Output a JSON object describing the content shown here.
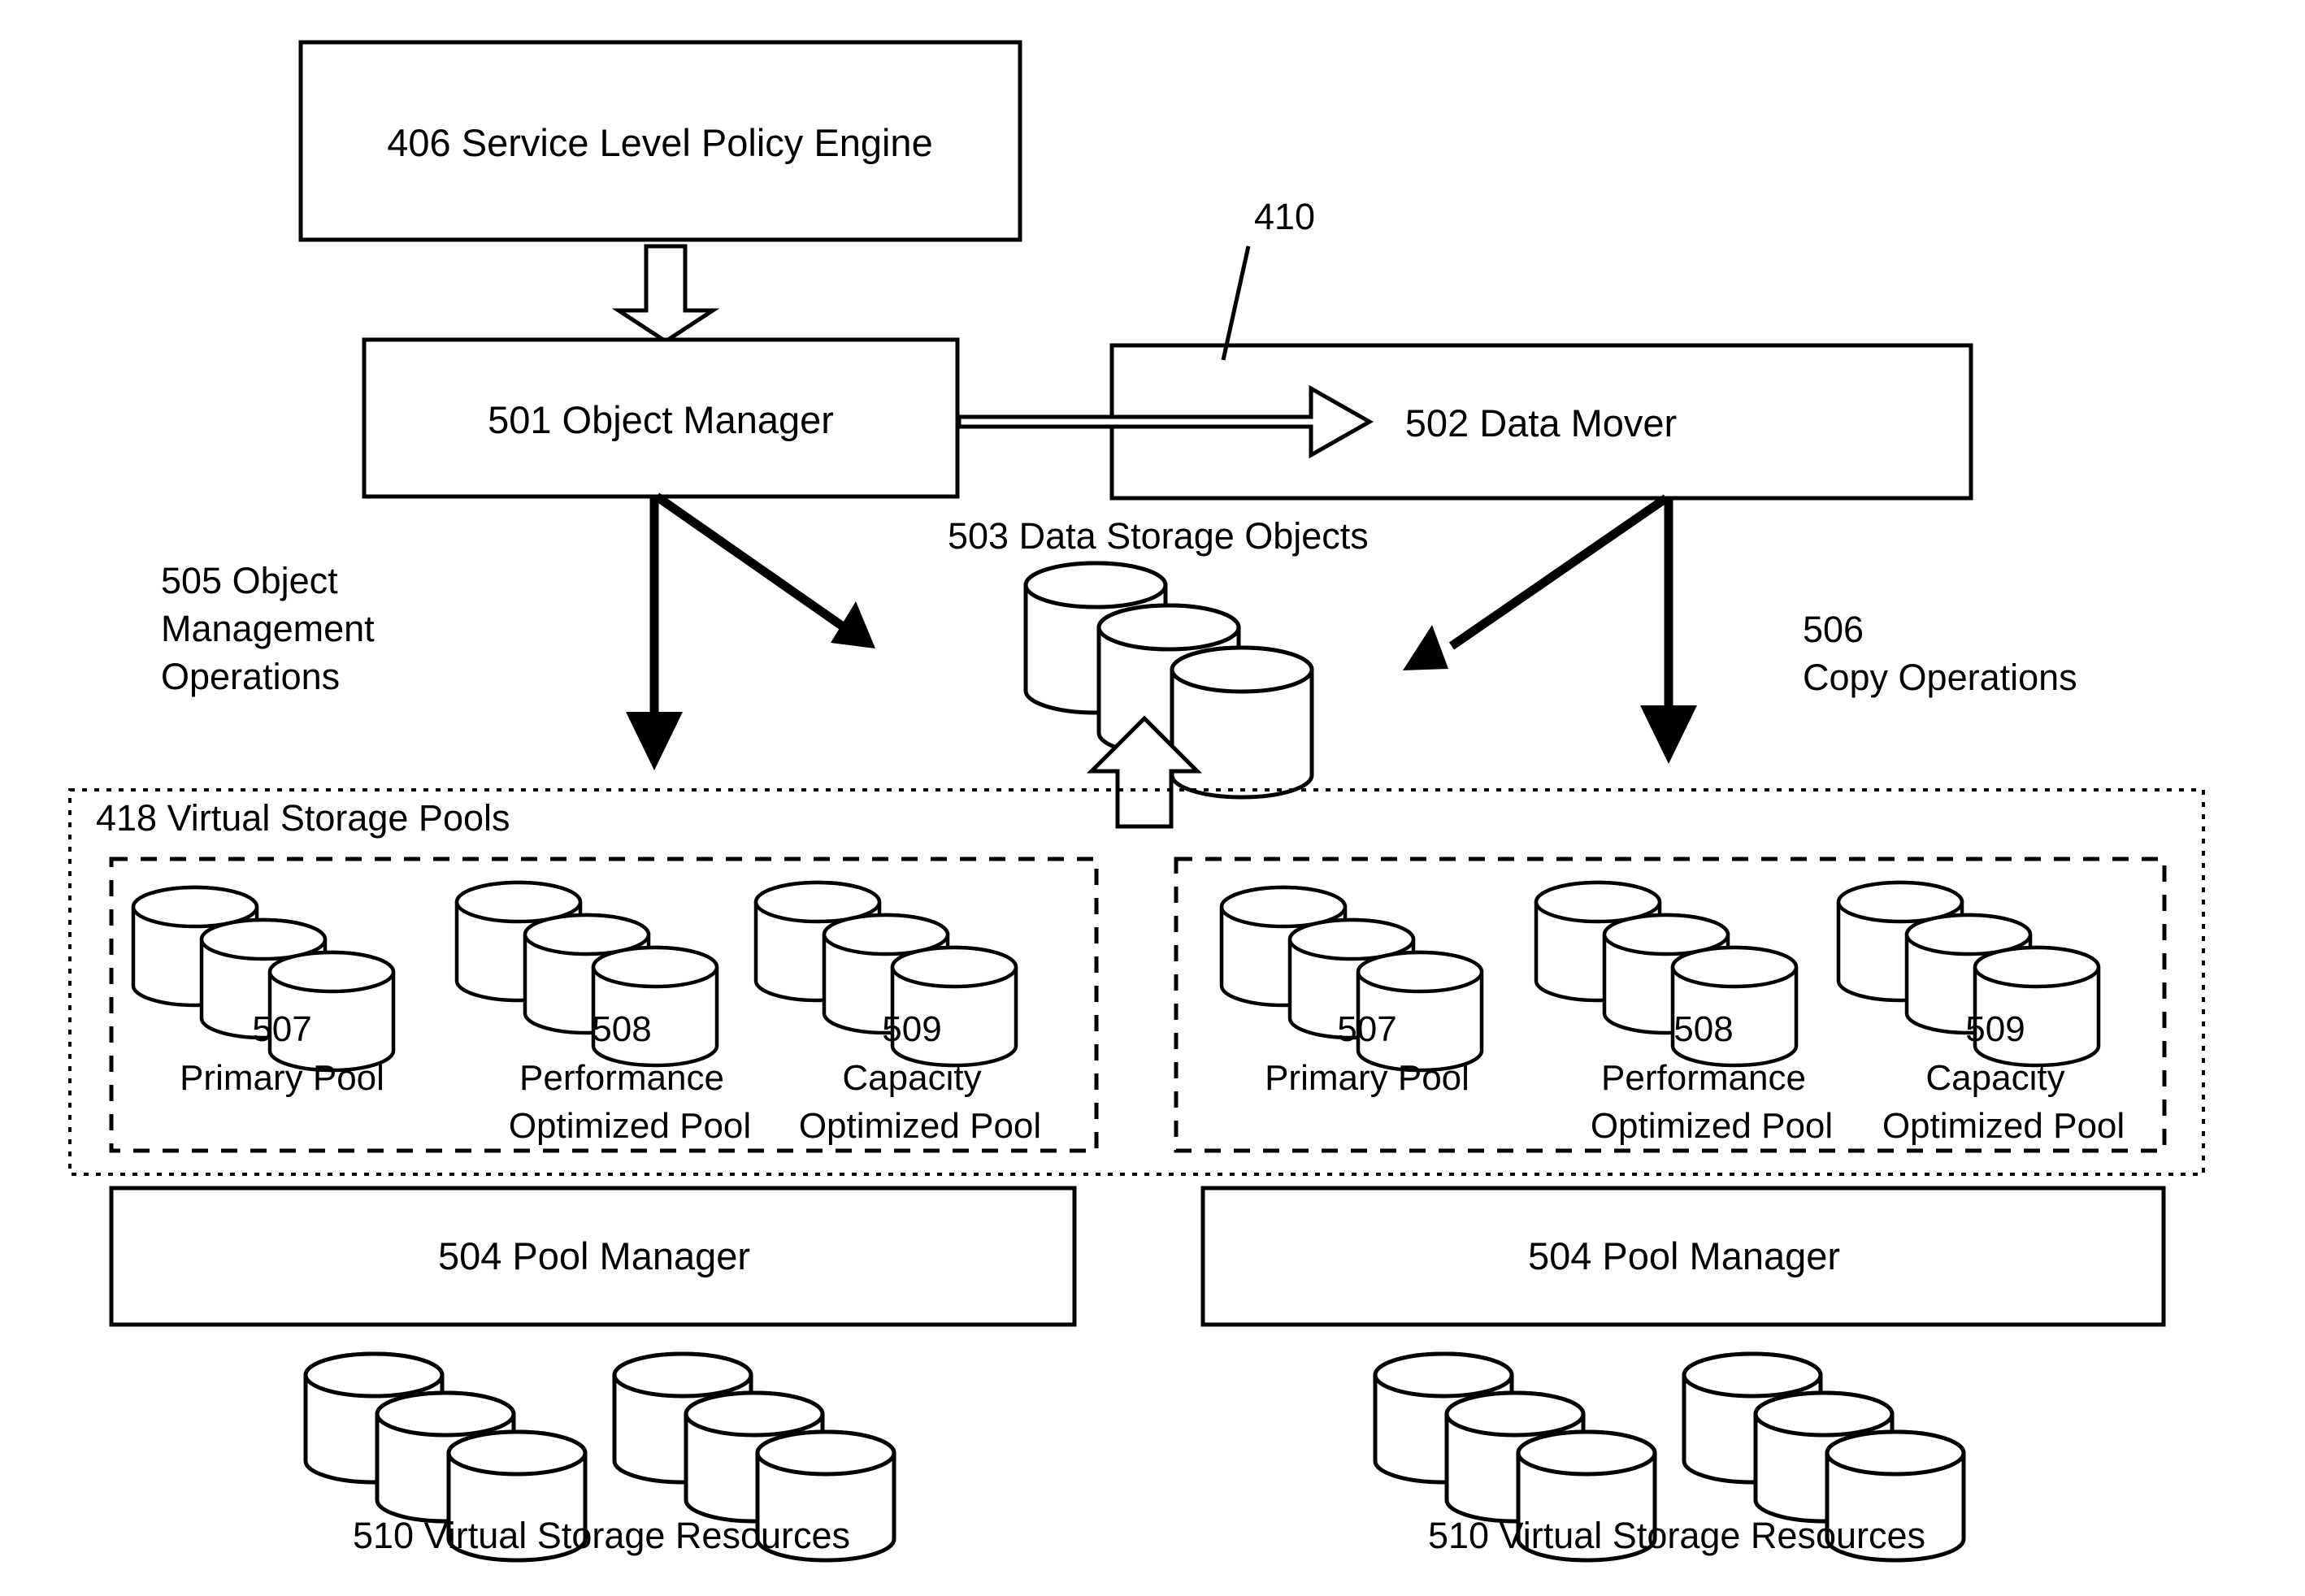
{
  "figure": {
    "title_blocks": {
      "policy_engine": "406 Service Level Policy Engine",
      "object_manager": "501 Object Manager",
      "data_mover": "502 Data Mover",
      "pool_manager_left": "504 Pool Manager",
      "pool_manager_right": "504 Pool Manager"
    },
    "labels": {
      "ref_410": "410",
      "object_mgmt_line1": "505 Object",
      "object_mgmt_line2": "Management",
      "object_mgmt_line3": "Operations",
      "data_storage_objects": "503 Data Storage Objects",
      "copy_ops_line1": "506",
      "copy_ops_line2": "Copy Operations",
      "virtual_storage_pools": "418 Virtual Storage Pools",
      "virtual_storage_resources_left": "510 Virtual Storage Resources",
      "virtual_storage_resources_right": "510 Virtual Storage Resources"
    },
    "pools_left": [
      {
        "num": "507",
        "name_line1": "Primary Pool",
        "name_line2": ""
      },
      {
        "num": "508",
        "name_line1": "Performance",
        "name_line2": "Optimized Pool"
      },
      {
        "num": "509",
        "name_line1": "Capacity",
        "name_line2": "Optimized Pool"
      }
    ],
    "pools_right": [
      {
        "num": "507",
        "name_line1": "Primary Pool",
        "name_line2": ""
      },
      {
        "num": "508",
        "name_line1": "Performance",
        "name_line2": "Optimized Pool"
      },
      {
        "num": "509",
        "name_line1": "Capacity",
        "name_line2": "Optimized Pool"
      }
    ],
    "colors": {
      "stroke": "#000000",
      "fill": "#ffffff",
      "background": "#ffffff"
    }
  }
}
